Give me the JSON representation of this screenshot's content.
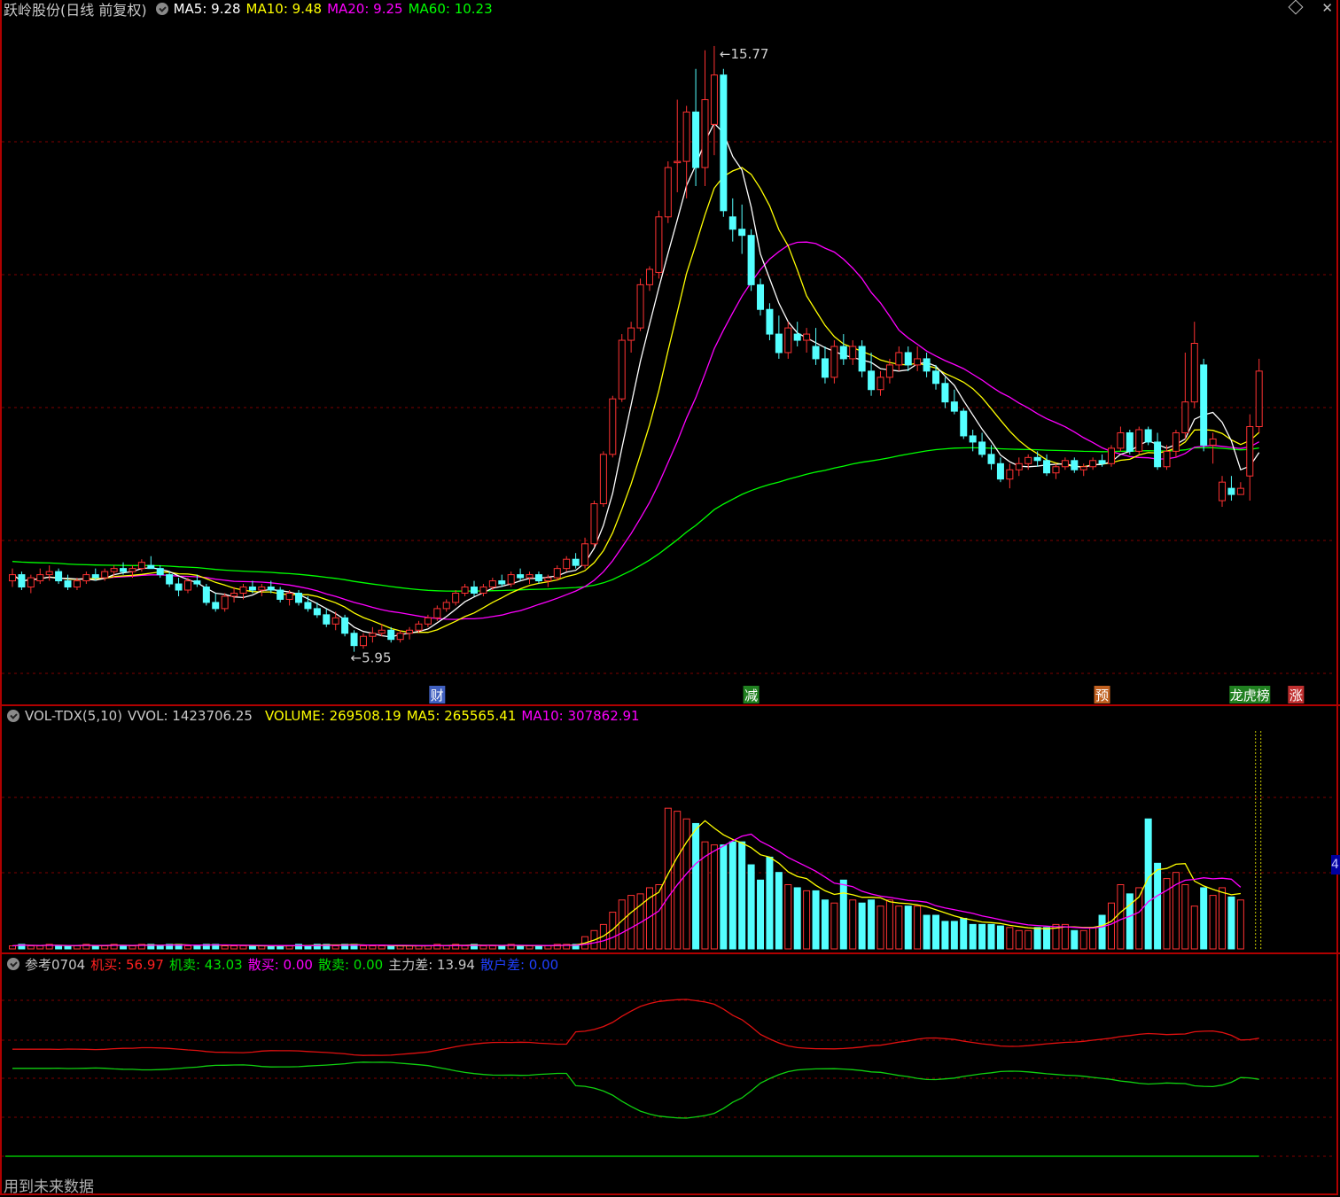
{
  "main_header": {
    "title": "跃岭股份(日线 前复权)",
    "ma5": "MA5: 9.28",
    "ma10": "MA10: 9.48",
    "ma20": "MA20: 9.25",
    "ma60": "MA60: 10.23"
  },
  "price_labels": {
    "high": "15.77",
    "low": "5.95"
  },
  "event_markers": [
    {
      "label": "财",
      "color": "#4060c0"
    },
    {
      "label": "减",
      "color": "#208020"
    },
    {
      "label": "预",
      "color": "#c06020"
    },
    {
      "label": "龙虎榜",
      "color": "#208020"
    },
    {
      "label": "涨",
      "color": "#c03030"
    }
  ],
  "vol_header": {
    "name": "VOL-TDX(5,10)",
    "vvol": "VVOL: 1423706.25",
    "volume": "VOLUME: 269508.19",
    "ma5": "MA5: 265565.41",
    "ma10": "MA10: 307862.91"
  },
  "vol_side_label": "4",
  "ind_header": {
    "name": "参考0704",
    "jimai": "机买: 56.97",
    "jimai_sell": "机卖: 43.03",
    "sanmai": "散买: 0.00",
    "sanmai_sell": "散卖: 0.00",
    "zhulicha": "主力差: 13.94",
    "sanhucha": "散户差: 0.00"
  },
  "footer_text": "用到未来数据",
  "colors": {
    "up": "#ff3232",
    "down": "#54ffff",
    "ma5": "#ffffff",
    "ma10": "#ffff00",
    "ma20": "#ff00ff",
    "ma60": "#00ff00",
    "grid": "#800000"
  },
  "candles": [
    [
      7.1,
      7.3,
      7.0,
      7.2
    ],
    [
      7.2,
      7.25,
      6.95,
      7.0
    ],
    [
      7.0,
      7.2,
      6.9,
      7.15
    ],
    [
      7.1,
      7.3,
      7.05,
      7.2
    ],
    [
      7.2,
      7.35,
      7.1,
      7.25
    ],
    [
      7.25,
      7.3,
      7.05,
      7.1
    ],
    [
      7.1,
      7.2,
      6.95,
      7.0
    ],
    [
      7.0,
      7.15,
      6.95,
      7.1
    ],
    [
      7.1,
      7.25,
      7.05,
      7.2
    ],
    [
      7.2,
      7.3,
      7.1,
      7.15
    ],
    [
      7.15,
      7.3,
      7.1,
      7.25
    ],
    [
      7.25,
      7.35,
      7.15,
      7.3
    ],
    [
      7.3,
      7.4,
      7.2,
      7.25
    ],
    [
      7.25,
      7.35,
      7.15,
      7.3
    ],
    [
      7.3,
      7.45,
      7.25,
      7.4
    ],
    [
      7.35,
      7.5,
      7.3,
      7.3
    ],
    [
      7.3,
      7.35,
      7.15,
      7.2
    ],
    [
      7.2,
      7.25,
      7.0,
      7.05
    ],
    [
      7.05,
      7.15,
      6.85,
      6.95
    ],
    [
      6.95,
      7.15,
      6.9,
      7.1
    ],
    [
      7.1,
      7.2,
      7.0,
      7.05
    ],
    [
      7.0,
      7.05,
      6.7,
      6.75
    ],
    [
      6.75,
      6.9,
      6.6,
      6.65
    ],
    [
      6.65,
      6.9,
      6.6,
      6.85
    ],
    [
      6.85,
      7.0,
      6.75,
      6.9
    ],
    [
      6.9,
      7.05,
      6.8,
      7.0
    ],
    [
      7.0,
      7.1,
      6.9,
      6.95
    ],
    [
      6.95,
      7.05,
      6.85,
      7.0
    ],
    [
      7.0,
      7.1,
      6.9,
      6.95
    ],
    [
      6.95,
      7.0,
      6.75,
      6.8
    ],
    [
      6.8,
      6.95,
      6.7,
      6.9
    ],
    [
      6.9,
      6.95,
      6.7,
      6.75
    ],
    [
      6.75,
      6.85,
      6.6,
      6.65
    ],
    [
      6.65,
      6.75,
      6.5,
      6.55
    ],
    [
      6.55,
      6.65,
      6.35,
      6.4
    ],
    [
      6.4,
      6.6,
      6.3,
      6.5
    ],
    [
      6.5,
      6.55,
      6.2,
      6.25
    ],
    [
      6.25,
      6.3,
      5.95,
      6.05
    ],
    [
      6.05,
      6.25,
      6.0,
      6.2
    ],
    [
      6.2,
      6.35,
      6.1,
      6.25
    ],
    [
      6.25,
      6.4,
      6.2,
      6.3
    ],
    [
      6.3,
      6.35,
      6.1,
      6.15
    ],
    [
      6.15,
      6.3,
      6.1,
      6.25
    ],
    [
      6.25,
      6.35,
      6.15,
      6.3
    ],
    [
      6.3,
      6.45,
      6.25,
      6.4
    ],
    [
      6.4,
      6.55,
      6.35,
      6.5
    ],
    [
      6.5,
      6.7,
      6.45,
      6.65
    ],
    [
      6.65,
      6.8,
      6.6,
      6.75
    ],
    [
      6.75,
      6.95,
      6.7,
      6.9
    ],
    [
      6.9,
      7.05,
      6.85,
      7.0
    ],
    [
      7.0,
      7.1,
      6.85,
      6.9
    ],
    [
      6.9,
      7.05,
      6.85,
      7.0
    ],
    [
      7.0,
      7.15,
      6.95,
      7.1
    ],
    [
      7.1,
      7.2,
      7.0,
      7.05
    ],
    [
      7.05,
      7.25,
      7.0,
      7.2
    ],
    [
      7.2,
      7.3,
      7.1,
      7.15
    ],
    [
      7.15,
      7.25,
      7.05,
      7.2
    ],
    [
      7.2,
      7.25,
      7.05,
      7.1
    ],
    [
      7.1,
      7.2,
      7.0,
      7.15
    ],
    [
      7.15,
      7.35,
      7.1,
      7.3
    ],
    [
      7.3,
      7.5,
      7.25,
      7.45
    ],
    [
      7.45,
      7.55,
      7.3,
      7.35
    ],
    [
      7.35,
      7.8,
      7.3,
      7.7
    ],
    [
      7.7,
      8.4,
      7.65,
      8.35
    ],
    [
      8.35,
      9.2,
      8.3,
      9.15
    ],
    [
      9.15,
      10.1,
      9.1,
      10.05
    ],
    [
      10.05,
      11.1,
      10.0,
      11.0
    ],
    [
      11.0,
      11.3,
      10.8,
      11.2
    ],
    [
      11.2,
      12.0,
      11.15,
      11.9
    ],
    [
      11.9,
      12.2,
      11.8,
      12.15
    ],
    [
      12.1,
      13.1,
      12.0,
      13.0
    ],
    [
      13.0,
      13.9,
      12.9,
      13.8
    ],
    [
      13.9,
      14.9,
      13.4,
      13.9
    ],
    [
      13.9,
      14.8,
      13.3,
      14.7
    ],
    [
      14.7,
      15.4,
      13.5,
      13.8
    ],
    [
      13.8,
      15.7,
      13.5,
      14.9
    ],
    [
      14.5,
      15.77,
      14.0,
      15.3
    ],
    [
      15.3,
      15.4,
      13.0,
      13.1
    ],
    [
      13.0,
      13.3,
      12.6,
      12.8
    ],
    [
      12.8,
      13.2,
      12.4,
      12.7
    ],
    [
      12.7,
      12.8,
      11.8,
      11.9
    ],
    [
      11.9,
      12.0,
      11.4,
      11.5
    ],
    [
      11.5,
      11.6,
      11.0,
      11.1
    ],
    [
      11.1,
      11.4,
      10.7,
      10.8
    ],
    [
      10.8,
      11.3,
      10.7,
      11.2
    ],
    [
      11.1,
      11.3,
      10.9,
      11.0
    ],
    [
      11.0,
      11.2,
      10.8,
      11.1
    ],
    [
      10.9,
      11.2,
      10.6,
      10.7
    ],
    [
      10.7,
      10.9,
      10.3,
      10.4
    ],
    [
      10.4,
      11.0,
      10.3,
      10.9
    ],
    [
      10.9,
      11.1,
      10.6,
      10.7
    ],
    [
      10.7,
      11.0,
      10.6,
      10.9
    ],
    [
      10.9,
      11.0,
      10.4,
      10.5
    ],
    [
      10.5,
      10.8,
      10.1,
      10.2
    ],
    [
      10.2,
      10.5,
      10.1,
      10.4
    ],
    [
      10.4,
      10.7,
      10.3,
      10.6
    ],
    [
      10.6,
      10.9,
      10.5,
      10.8
    ],
    [
      10.8,
      10.9,
      10.5,
      10.6
    ],
    [
      10.6,
      10.9,
      10.5,
      10.7
    ],
    [
      10.7,
      10.8,
      10.4,
      10.5
    ],
    [
      10.5,
      10.6,
      10.2,
      10.3
    ],
    [
      10.3,
      10.4,
      9.9,
      10.0
    ],
    [
      10.0,
      10.2,
      9.8,
      9.85
    ],
    [
      9.85,
      9.9,
      9.4,
      9.45
    ],
    [
      9.45,
      9.55,
      9.2,
      9.35
    ],
    [
      9.35,
      9.5,
      9.1,
      9.15
    ],
    [
      9.15,
      9.3,
      8.9,
      9.0
    ],
    [
      9.0,
      9.1,
      8.7,
      8.75
    ],
    [
      8.75,
      9.0,
      8.6,
      8.9
    ],
    [
      8.9,
      9.1,
      8.8,
      9.0
    ],
    [
      9.0,
      9.15,
      8.9,
      9.1
    ],
    [
      9.1,
      9.2,
      8.95,
      9.05
    ],
    [
      9.05,
      9.15,
      8.8,
      8.85
    ],
    [
      8.85,
      9.0,
      8.75,
      8.95
    ],
    [
      8.95,
      9.1,
      8.9,
      9.05
    ],
    [
      9.05,
      9.1,
      8.85,
      8.9
    ],
    [
      8.9,
      9.0,
      8.8,
      8.95
    ],
    [
      8.95,
      9.1,
      8.9,
      9.05
    ],
    [
      9.05,
      9.15,
      8.95,
      9.0
    ],
    [
      9.0,
      9.3,
      8.95,
      9.25
    ],
    [
      9.25,
      9.6,
      9.2,
      9.5
    ],
    [
      9.5,
      9.55,
      9.15,
      9.2
    ],
    [
      9.2,
      9.6,
      9.15,
      9.55
    ],
    [
      9.55,
      9.6,
      9.3,
      9.35
    ],
    [
      9.35,
      9.5,
      8.9,
      8.95
    ],
    [
      8.95,
      9.3,
      8.9,
      9.2
    ],
    [
      9.2,
      9.55,
      9.1,
      9.5
    ],
    [
      9.5,
      10.8,
      9.4,
      10.0
    ],
    [
      10.0,
      11.3,
      9.9,
      10.95
    ],
    [
      10.6,
      10.7,
      9.2,
      9.3
    ],
    [
      9.3,
      9.5,
      9.0,
      9.4
    ],
    [
      8.4,
      8.8,
      8.3,
      8.7
    ],
    [
      8.6,
      8.8,
      8.4,
      8.5
    ],
    [
      8.5,
      8.7,
      8.5,
      8.6
    ],
    [
      8.8,
      9.8,
      8.4,
      9.6
    ],
    [
      9.6,
      10.7,
      9.5,
      10.5
    ]
  ],
  "volumes": [
    2,
    3,
    2,
    2,
    3,
    2,
    2,
    2,
    3,
    2,
    2,
    3,
    2,
    2,
    3,
    3,
    2,
    3,
    3,
    2,
    2,
    3,
    3,
    2,
    2,
    2,
    2,
    2,
    2,
    2,
    2,
    3,
    2,
    3,
    3,
    2,
    3,
    3,
    2,
    2,
    2,
    2,
    2,
    2,
    2,
    2,
    3,
    2,
    3,
    2,
    3,
    2,
    2,
    2,
    3,
    2,
    2,
    2,
    2,
    3,
    3,
    3,
    8,
    12,
    16,
    24,
    32,
    35,
    36,
    40,
    42,
    92,
    90,
    85,
    82,
    70,
    68,
    68,
    70,
    70,
    55,
    45,
    60,
    50,
    42,
    40,
    38,
    38,
    32,
    30,
    45,
    32,
    30,
    32,
    28,
    32,
    28,
    28,
    28,
    22,
    22,
    18,
    18,
    20,
    16,
    16,
    16,
    15,
    14,
    12,
    12,
    14,
    14,
    16,
    16,
    12,
    12,
    14,
    22,
    30,
    42,
    36,
    40,
    85,
    56,
    46,
    50,
    42,
    28,
    40,
    35,
    40,
    34,
    32
  ],
  "ma60_start": 7.42
}
